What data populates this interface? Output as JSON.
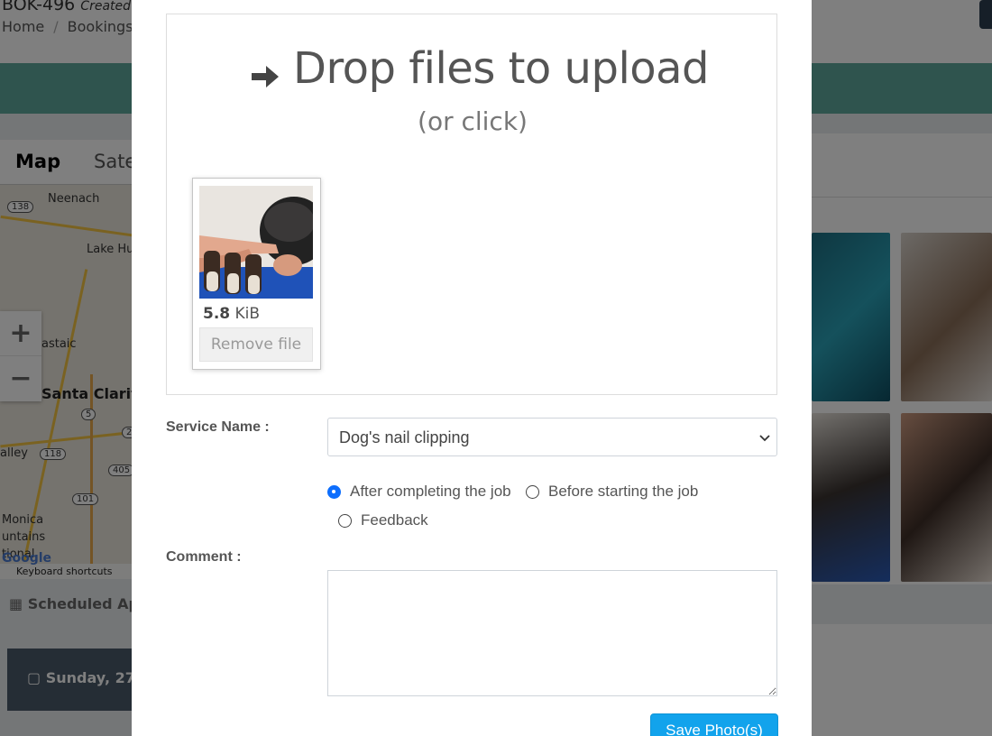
{
  "background": {
    "booking_code": "BOK-496",
    "booking_created": "Created",
    "breadcrumb": [
      "Home",
      "Bookings"
    ],
    "map": {
      "tab_map": "Map",
      "tab_satellite": "Sate",
      "zoom_in": "+",
      "zoom_out": "−",
      "labels": [
        "Neenach",
        "Lake Hu",
        "astaic",
        "Santa Clarit",
        "alley",
        "Monica",
        "untains",
        "tional"
      ],
      "shields": [
        "138",
        "5",
        "118",
        "405",
        "101",
        "2"
      ],
      "keyboard_shortcuts": "Keyboard shortcuts",
      "google_logo": "Google"
    },
    "scheduled_label": "Scheduled App",
    "date_label": "Sunday, 27"
  },
  "modal": {
    "dropzone": {
      "title": "Drop files to upload",
      "subtitle": "(or click)"
    },
    "preview": {
      "size_value": "5.8",
      "size_unit": "KiB",
      "remove_label": "Remove file"
    },
    "service_label": "Service Name :",
    "service_value": "Dog's nail clipping",
    "radios": [
      {
        "label": "After completing the job",
        "checked": true
      },
      {
        "label": "Before starting the job",
        "checked": false
      },
      {
        "label": "Feedback",
        "checked": false
      }
    ],
    "comment_label": "Comment :",
    "comment_value": "",
    "save_label": "Save Photo(s)"
  },
  "colors": {
    "teal_bar": "#5fa89d",
    "primary_radio": "#0d6efd",
    "save_button": "#12a3ec"
  }
}
